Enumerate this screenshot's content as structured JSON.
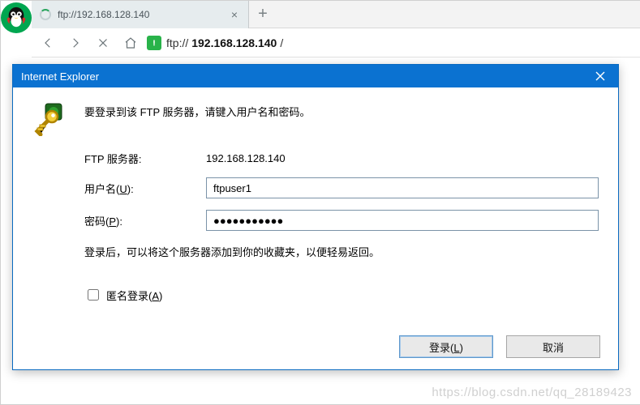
{
  "browser": {
    "tab": {
      "title": "ftp://192.168.128.140",
      "loading": true
    },
    "address": {
      "scheme": "ftp://",
      "host": "192.168.128.140",
      "suffix": "/"
    }
  },
  "dialog": {
    "title": "Internet Explorer",
    "prompt": "要登录到该 FTP 服务器，请键入用户名和密码。",
    "labels": {
      "server": "FTP 服务器:",
      "username_prefix": "用户名(",
      "username_key": "U",
      "username_suffix": "):",
      "password_prefix": "密码(",
      "password_key": "P",
      "password_suffix": "):",
      "anon_prefix": "匿名登录(",
      "anon_key": "A",
      "anon_suffix": ")",
      "login_prefix": "登录(",
      "login_key": "L",
      "login_suffix": ")",
      "cancel": "取消"
    },
    "values": {
      "server": "192.168.128.140",
      "username": "ftpuser1",
      "password": "●●●●●●●●●●●",
      "anon_checked": false
    },
    "note_after_login": "登录后，可以将这个服务器添加到你的收藏夹，以便轻易返回。"
  },
  "watermark": "https://blog.csdn.net/qq_28189423"
}
